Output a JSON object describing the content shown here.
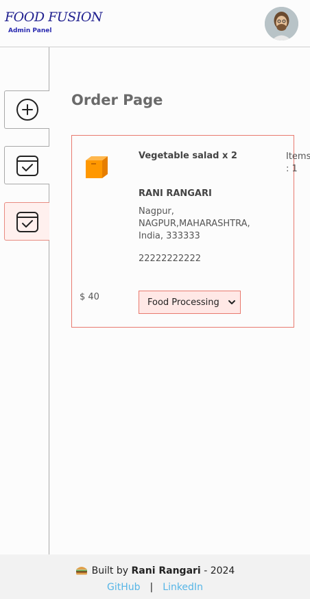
{
  "navbar": {
    "brand_title": "FOOD FUSION",
    "brand_subtitle": "Admin Panel",
    "avatar_icon": "profile-avatar"
  },
  "sidebar": {
    "items": [
      {
        "icon": "add-circle-icon",
        "active": false
      },
      {
        "icon": "checklist-icon",
        "active": false
      },
      {
        "icon": "checklist-icon",
        "active": true
      }
    ]
  },
  "main": {
    "page_title": "Order Page",
    "orders": [
      {
        "items": "Vegetable salad x 2",
        "items_count_label": "Items : 1",
        "customer_name": "RANI RANGARI",
        "address": "Nagpur, NAGPUR,MAHARASHTRA, India, 333333",
        "phone": "22222222222",
        "amount": "$ 40",
        "status": "Food Processing"
      }
    ]
  },
  "footer": {
    "built_by_prefix": "Built by",
    "author": "Rani Rangari",
    "year_suffix": "- 2024",
    "github_label": "GitHub",
    "separator": "|",
    "linkedin_label": "LinkedIn"
  },
  "colors": {
    "brand": "#20208f",
    "accent_border": "#e8796e",
    "accent_bg": "#ffe8e6",
    "link": "#56b5e6"
  }
}
